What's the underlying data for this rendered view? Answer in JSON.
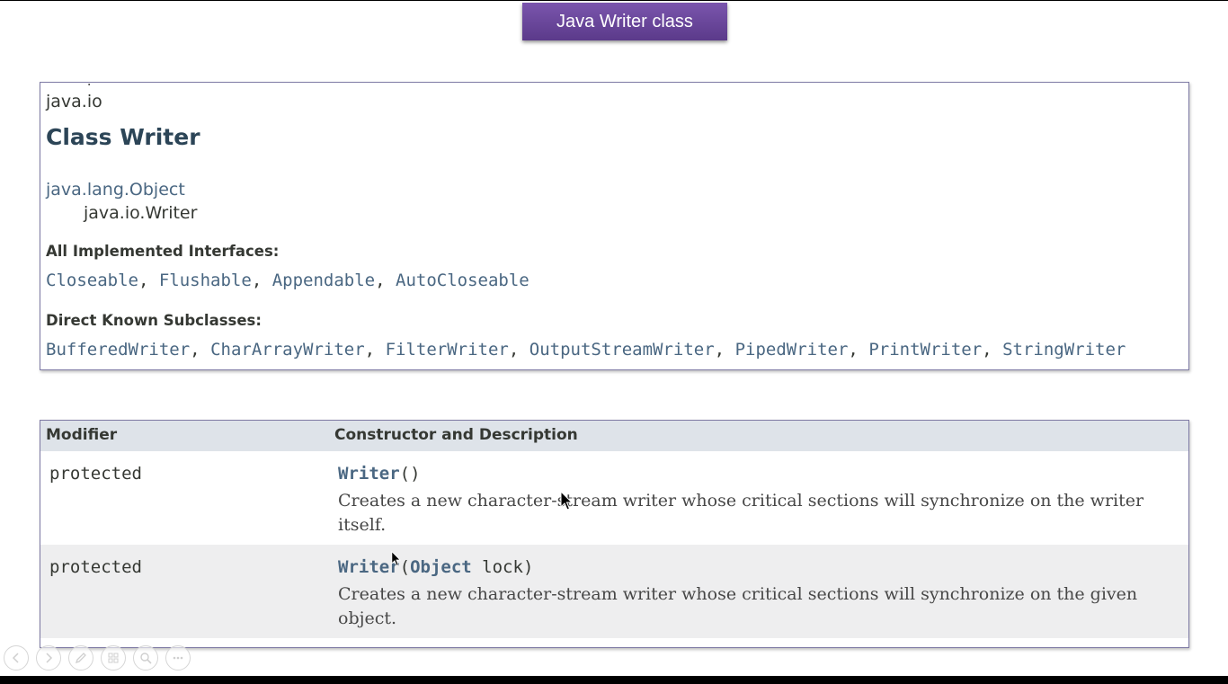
{
  "slide": {
    "title": "Java Writer class"
  },
  "doc": {
    "clipped_text": "- - -   .   - - - -   -  -",
    "package": "java.io",
    "class_title": "Class Writer",
    "inheritance": [
      "java.lang.Object",
      "java.io.Writer"
    ],
    "interfaces_label": "All Implemented Interfaces:",
    "interfaces": [
      "Closeable",
      "Flushable",
      "Appendable",
      "AutoCloseable"
    ],
    "subclasses_label": "Direct Known Subclasses:",
    "subclasses": [
      "BufferedWriter",
      "CharArrayWriter",
      "FilterWriter",
      "OutputStreamWriter",
      "PipedWriter",
      "PrintWriter",
      "StringWriter"
    ],
    "separator": ","
  },
  "constructors": {
    "header_modifier": "Modifier",
    "header_description": "Constructor and Description",
    "rows": [
      {
        "modifier": "protected",
        "name": "Writer",
        "params_open": "(",
        "param_type": "",
        "param_name": "",
        "params_close": ")",
        "description": "Creates a new character-stream writer whose critical sections will synchronize on the writer itself."
      },
      {
        "modifier": "protected",
        "name": "Writer",
        "params_open": "(",
        "param_type": "Object",
        "param_name": " lock",
        "params_close": ")",
        "description": "Creates a new character-stream writer whose critical sections will synchronize on the given object."
      }
    ]
  },
  "controls": [
    "previous-icon",
    "next-icon",
    "pen-icon",
    "slides-icon",
    "zoom-icon",
    "more-icon"
  ],
  "colors": {
    "title_bar": "#6b4a9b",
    "link": "#4a6782",
    "heading": "#2c4557",
    "table_header": "#dee3e9",
    "alt_row": "#eeeeef"
  }
}
